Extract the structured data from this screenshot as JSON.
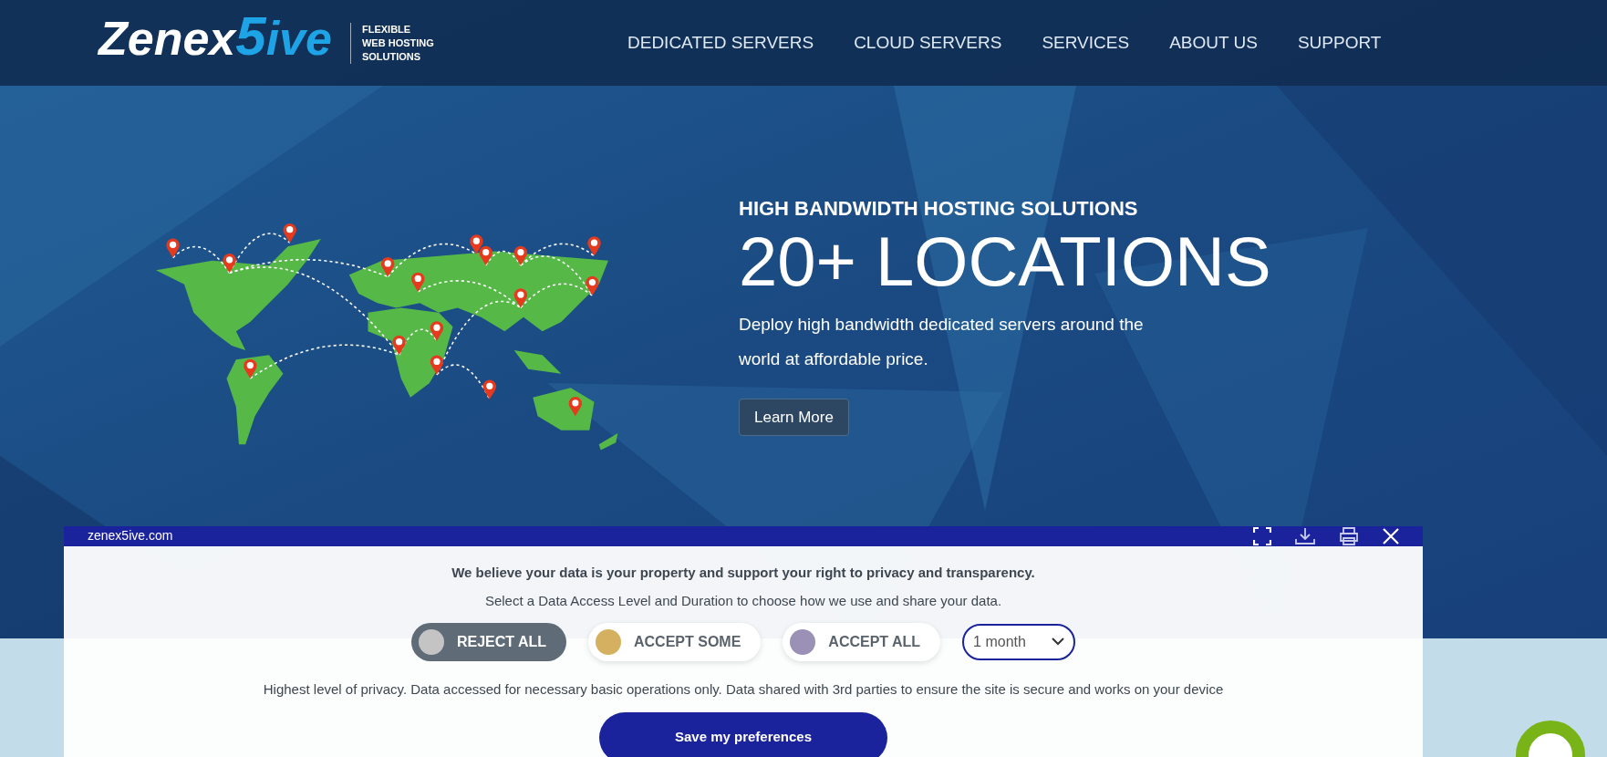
{
  "header": {
    "logo": {
      "name": "Zenex",
      "digit": "5",
      "suffix": "ive"
    },
    "tagline": [
      "FLEXIBLE",
      "WEB HOSTING",
      "SOLUTIONS"
    ],
    "nav": [
      "DEDICATED SERVERS",
      "CLOUD SERVERS",
      "SERVICES",
      "ABOUT US",
      "SUPPORT"
    ]
  },
  "hero": {
    "eyebrow": "HIGH BANDWIDTH HOSTING SOLUTIONS",
    "title": "20+ LOCATIONS",
    "text": "Deploy high bandwidth dedicated servers around the world at affordable price.",
    "button": "Learn More"
  },
  "consent_dialog": {
    "site": "zenex5ive.com",
    "heading": "We believe your data is your property and support your right to privacy and transparency.",
    "subheading": "Select a Data Access Level and Duration to choose how we use and share your data.",
    "levels": [
      {
        "label": "REJECT ALL",
        "color": "#c4c4c4",
        "selected": true
      },
      {
        "label": "ACCEPT SOME",
        "color": "#d4b060",
        "selected": false
      },
      {
        "label": "ACCEPT ALL",
        "color": "#9b90b6",
        "selected": false
      }
    ],
    "duration": "1 month",
    "description": "Highest level of privacy. Data accessed for necessary basic operations only. Data shared with 3rd parties to ensure the site is secure and works on your device",
    "save_button": "Save my preferences"
  }
}
